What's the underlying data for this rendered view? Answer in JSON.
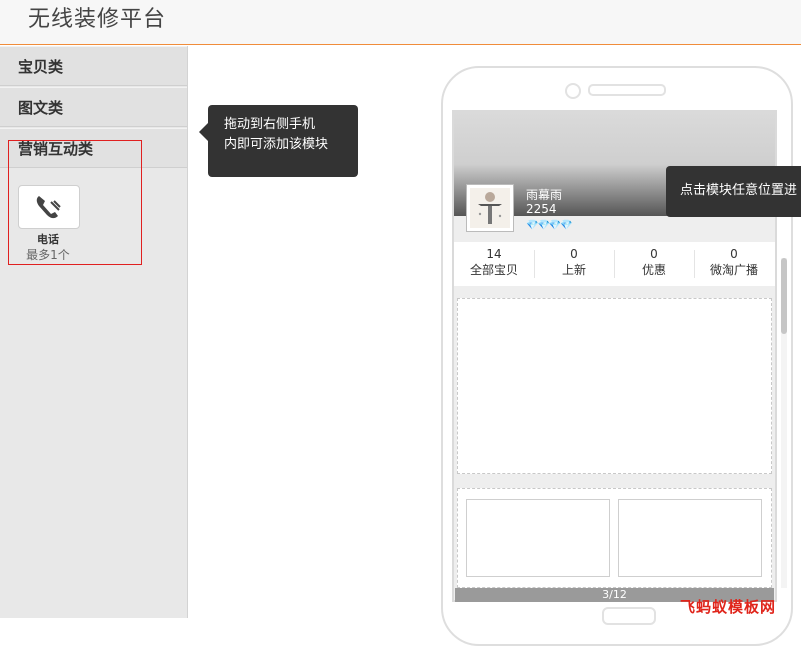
{
  "header": {
    "title": "无线装修平台"
  },
  "sidebar": {
    "categories": [
      {
        "label": "宝贝类"
      },
      {
        "label": "图文类"
      },
      {
        "label": "营销互动类"
      }
    ],
    "module": {
      "name": "电话",
      "limit": "最多1个",
      "icon": "phone-icon"
    }
  },
  "tips": {
    "drag": "拖动到右侧手机内即可添加该模块",
    "drag_line1": "拖动到右侧手机",
    "drag_line2": "内即可添加该模块",
    "click": "点击模块任意位置进"
  },
  "phone": {
    "shop": {
      "name": "雨幕雨",
      "number": "2254",
      "diamonds": "💎💎💎💎"
    },
    "stats": [
      {
        "value": "14",
        "label": "全部宝贝"
      },
      {
        "value": "0",
        "label": "上新"
      },
      {
        "value": "0",
        "label": "优惠"
      },
      {
        "value": "0",
        "label": "微淘广播"
      }
    ],
    "pager": "3/12"
  },
  "watermark": "飞蚂蚁模板网",
  "colors": {
    "accent": "#f08c3a",
    "tooltip": "#333333",
    "highlight_box": "#e02020"
  }
}
